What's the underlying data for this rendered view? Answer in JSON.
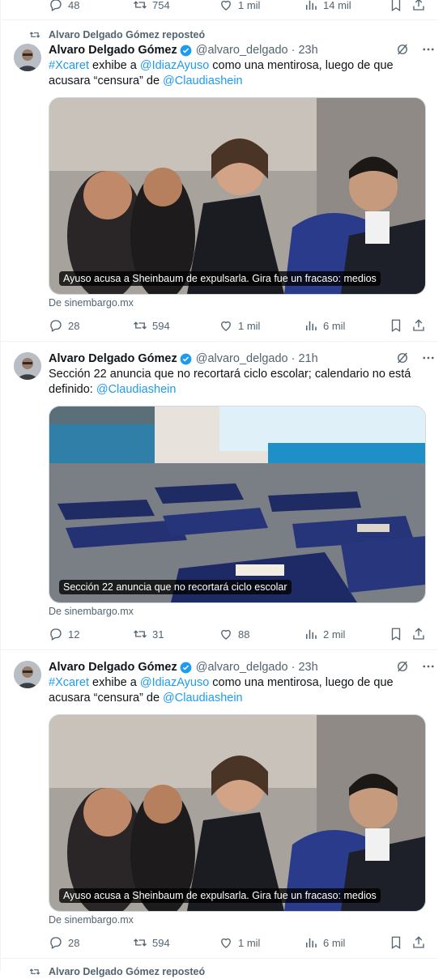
{
  "colors": {
    "accent": "#1d9bf0",
    "muted": "#536471",
    "text": "#0f1419",
    "divider": "#eff3f4"
  },
  "top_actions": {
    "replies": "48",
    "reposts": "754",
    "likes": "1 mil",
    "views": "14 mil"
  },
  "tweets": [
    {
      "repost_label": "Alvaro Delgado Gómez reposteó",
      "author": "Alvaro Delgado Gómez",
      "handle": "@alvaro_delgado",
      "time": "· 23h",
      "text_parts": [
        "#Xcaret",
        " exhibe a ",
        "@IdiazAyuso",
        " como una mentirosa, luego de que acusara “censura” de ",
        "@Claudiashein"
      ],
      "card_caption": "Ayuso acusa a Sheinbaum de expulsarla. Gira fue un fracaso: medios",
      "source": "De sinembargo.mx",
      "replies": "28",
      "reposts": "594",
      "likes": "1 mil",
      "views": "6 mil"
    },
    {
      "author": "Alvaro Delgado Gómez",
      "handle": "@alvaro_delgado",
      "time": "· 21h",
      "text_parts": [
        "Sección 22 anuncia que no recortará ciclo escolar; calendario no está definido: ",
        "@Claudiashein"
      ],
      "card_caption": "Sección 22 anuncia que no recortará ciclo escolar",
      "source": "De sinembargo.mx",
      "replies": "12",
      "reposts": "31",
      "likes": "88",
      "views": "2 mil"
    },
    {
      "author": "Alvaro Delgado Gómez",
      "handle": "@alvaro_delgado",
      "time": "· 23h",
      "text_parts": [
        "#Xcaret",
        " exhibe a ",
        "@IdiazAyuso",
        " como una mentirosa, luego de que acusara “censura” de ",
        "@Claudiashein"
      ],
      "card_caption": "Ayuso acusa a Sheinbaum de expulsarla. Gira fue un fracaso: medios",
      "source": "De sinembargo.mx",
      "replies": "28",
      "reposts": "594",
      "likes": "1 mil",
      "views": "6 mil"
    }
  ],
  "bottom_repost_label": "Alvaro Delgado Gómez reposteó"
}
